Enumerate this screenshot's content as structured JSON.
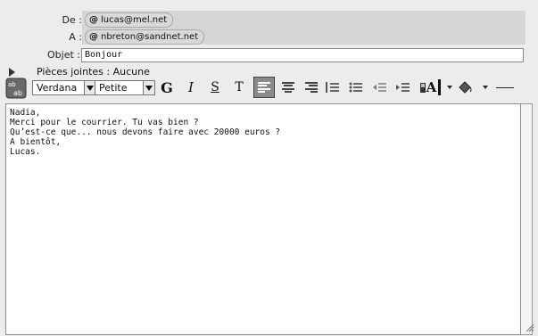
{
  "header": {
    "from_label": "De :",
    "to_label": "A :",
    "from_address": "lucas@mel.net",
    "to_address": "nbreton@sandnet.net",
    "subject_label": "Objet :",
    "subject_value": "Bonjour",
    "attachments_label": "Pièces jointes : Aucune"
  },
  "toolbar": {
    "font_family": "Verdana",
    "font_size": "Petite",
    "bold": "G",
    "italic": "I",
    "strike": "S",
    "text_size": "T",
    "text_color": "A"
  },
  "message": {
    "lines": [
      "Nadia,",
      "Merci pour le courrier. Tu vas bien ?",
      "Qu’est-ce que... nous devons faire avec 20000 euros ?",
      "A bientôt,",
      "Lucas."
    ]
  }
}
